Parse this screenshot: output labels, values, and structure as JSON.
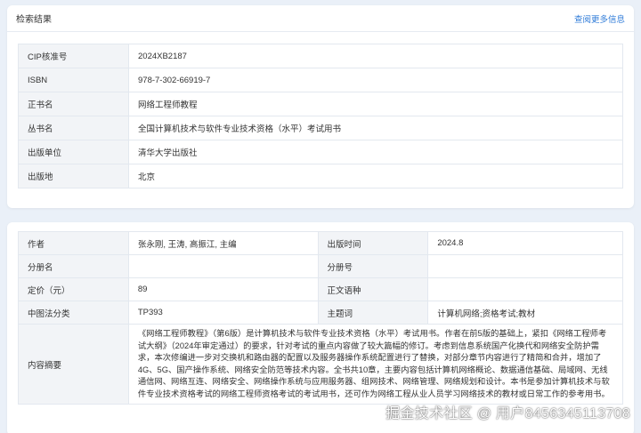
{
  "search_result": {
    "title": "检索结果",
    "more_link": "查阅更多信息",
    "rows": [
      {
        "label": "CIP核准号",
        "value": "2024XB2187"
      },
      {
        "label": "ISBN",
        "value": "978-7-302-66919-7"
      },
      {
        "label": "正书名",
        "value": "网络工程师教程"
      },
      {
        "label": "丛书名",
        "value": "全国计算机技术与软件专业技术资格（水平）考试用书"
      },
      {
        "label": "出版单位",
        "value": "清华大学出版社"
      },
      {
        "label": "出版地",
        "value": "北京"
      }
    ]
  },
  "details": {
    "author_label": "作者",
    "author_value": "张永刚, 王涛, 高振江, 主编",
    "pubtime_label": "出版时间",
    "pubtime_value": "2024.8",
    "part_name_label": "分册名",
    "part_name_value": "",
    "part_no_label": "分册号",
    "part_no_value": "",
    "price_label": "定价（元）",
    "price_value": "89",
    "language_label": "正文语种",
    "language_value": "",
    "clc_label": "中图法分类",
    "clc_value": "TP393",
    "subject_label": "主题词",
    "subject_value": "计算机网络;资格考试;教材",
    "abstract_label": "内容摘要",
    "abstract_value": "《网络工程师教程》（第6版）是计算机技术与软件专业技术资格（水平）考试用书。作者在前5版的基础上，紧扣《网络工程师考试大纲》（2024年审定通过）的要求，针对考试的重点内容做了较大篇幅的修订。考虑到信息系统国产化换代和网络安全防护需求，本次修编进一步对交换机和路由器的配置以及服务器操作系统配置进行了替换，对部分章节内容进行了精简和合并，增加了4G、5G、国产操作系统、网络安全防范等技术内容。全书共10章，主要内容包括计算机网络概论、数据通信基础、局域网、无线通信网、网络互连、网络安全、网络操作系统与应用服务器、组网技术、网络管理、网络规划和设计。本书是参加计算机技术与软件专业技术资格考试的网络工程师资格考试的考试用书，还可作为网络工程从业人员学习网络技术的教材或日常工作的参考用书。"
  },
  "watermark": "掘金技术社区 @ 用户8456345113708"
}
